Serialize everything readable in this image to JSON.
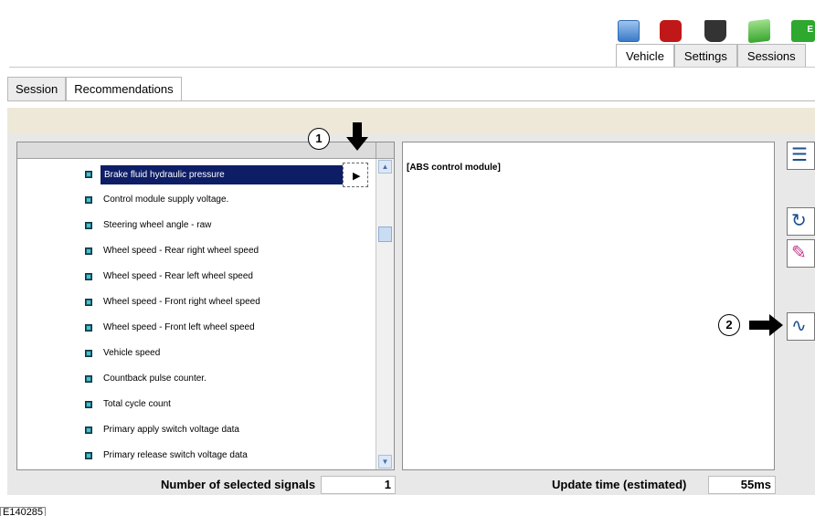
{
  "toolbar": {
    "icons": [
      "network-icon",
      "diagnostic-icon",
      "vehicle-interface-icon",
      "battery-icon",
      "user-icon"
    ],
    "icon5_text": "E"
  },
  "top_tabs": [
    {
      "label": "Vehicle",
      "active": true
    },
    {
      "label": "Settings",
      "active": false
    },
    {
      "label": "Sessions",
      "active": false
    }
  ],
  "sub_tabs": [
    {
      "label": "Session",
      "active": false
    },
    {
      "label": "Recommendations",
      "active": true
    }
  ],
  "signals": [
    {
      "label": "Brake fluid hydraulic pressure",
      "selected": true
    },
    {
      "label": "Control module supply voltage.",
      "selected": false
    },
    {
      "label": "Steering wheel angle - raw",
      "selected": false
    },
    {
      "label": "Wheel speed  -  Rear right wheel speed",
      "selected": false
    },
    {
      "label": "Wheel speed  -  Rear left wheel speed",
      "selected": false
    },
    {
      "label": "Wheel speed  -  Front right wheel speed",
      "selected": false
    },
    {
      "label": "Wheel speed  -  Front left wheel speed",
      "selected": false
    },
    {
      "label": "Vehicle speed",
      "selected": false
    },
    {
      "label": "Countback pulse counter.",
      "selected": false
    },
    {
      "label": "Total cycle count",
      "selected": false
    },
    {
      "label": "Primary apply switch voltage data",
      "selected": false
    },
    {
      "label": "Primary release switch voltage data",
      "selected": false
    }
  ],
  "info_panel": {
    "module": "[ABS control module]"
  },
  "callouts": {
    "one": "1",
    "two": "2"
  },
  "status": {
    "selected_label": "Number of selected signals",
    "selected_value": "1",
    "update_label": "Update time (estimated)",
    "update_value": "55ms"
  },
  "figure_ref": "E140285",
  "colors": {
    "selection": "#0d1d66",
    "bullet": "#18606c",
    "beige_bar": "#ede8d8"
  }
}
